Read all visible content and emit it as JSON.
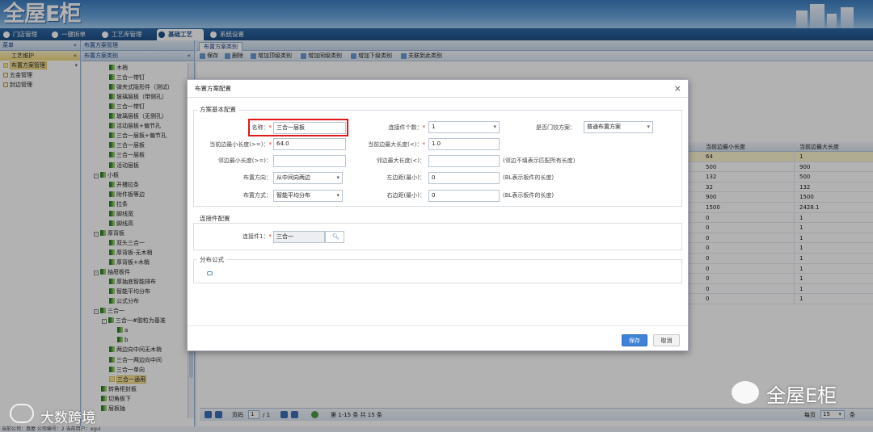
{
  "app": {
    "logo": "全屋E柜"
  },
  "nav": {
    "tabs": [
      "门店管理",
      "一键拆单",
      "工艺库管理",
      "基础工艺",
      "系统设置"
    ],
    "active": 3
  },
  "left_panel": {
    "header": "菜单",
    "section": "工艺维护",
    "items": [
      "布置方案管理",
      "五金管理",
      "封边管理"
    ],
    "selected": 0
  },
  "tree_panel": {
    "breadcrumb": "布置方案管理",
    "header": "布置方案类别",
    "items": [
      "木梢",
      "三合一带钉",
      "弹夹式隐形件（测试）",
      "玻璃层板（带侧孔）",
      "三合一带钉",
      "玻璃层板（无侧孔）",
      "活动层板+偏节孔",
      "三合一层板+偏节孔",
      "三合一层板",
      "三合一层板",
      "活动层板",
      "小板",
      "开槽拉条",
      "附件板等边",
      "拉条",
      "脚线宽",
      "脚线高",
      "厚背板",
      "双头三合一",
      "厚背板-无木梢",
      "厚背板+木梢",
      "抽屉板件",
      "厚抽底智能排布",
      "智能平均分布",
      "公式分布",
      "三合一",
      "三合一#胶粒为基准",
      "a",
      "b",
      "两边向中间无木梢",
      "三合一两边向中间",
      "三合一单向",
      "三合一通用",
      "转角柜封板",
      "切角板下",
      "层板抽"
    ],
    "selected_label": "三合一通用"
  },
  "main": {
    "tab": "布置方案类别",
    "toolbar": [
      "保存",
      "删除",
      "增加顶级类别",
      "增加同级类别",
      "增加下级类别",
      "关联到此类别"
    ],
    "grid_headers": [
      "当前边最小长度",
      "当前边最大长度"
    ],
    "grid_rows": [
      [
        "64",
        "1"
      ],
      [
        "500",
        "900"
      ],
      [
        "132",
        "500"
      ],
      [
        "32",
        "132"
      ],
      [
        "900",
        "1500"
      ],
      [
        "1500",
        "2428.1"
      ],
      [
        "0",
        "1"
      ],
      [
        "0",
        "1"
      ],
      [
        "0",
        "1"
      ],
      [
        "0",
        "1"
      ],
      [
        "0",
        "1"
      ],
      [
        "0",
        "1"
      ],
      [
        "0",
        "1"
      ],
      [
        "0",
        "1"
      ],
      [
        "0",
        "1"
      ]
    ],
    "highlighted_row": 0
  },
  "pager": {
    "page_label": "页码",
    "page": "1",
    "of": "/ 1",
    "summary": "第 1-15 条 共 15 条",
    "per_page_label": "每页",
    "per_page": "15",
    "unit": "条"
  },
  "status_bar": "当前公司：真屋   公司编号：2   当前用户：egui",
  "dialog": {
    "title": "布置方案配置",
    "section_basic": "方案基本配置",
    "fields": {
      "name_label": "名称：",
      "name_value": "三合一层板",
      "connector_count_label": "连接件个数：",
      "connector_count_value": "1",
      "is_door_label": "是否门铰方案：",
      "is_door_value": "普通布置方案",
      "cur_min_label": "当前边最小长度(>=)：",
      "cur_min_value": "64.0",
      "cur_max_label": "当前边最大长度(<)：",
      "cur_max_value": "1.0",
      "adj_min_label": "邻边最小长度(>=)：",
      "adj_min_value": "",
      "adj_max_label": "邻边最大长度(<)：",
      "adj_max_value": "",
      "adj_hint": "(邻边不填表示匹配所有长度)",
      "direction_label": "布置方向：",
      "direction_value": "从中间向两边",
      "left_margin_label": "左边距(最小)：",
      "left_margin_value": "0",
      "left_margin_hint": "(BL表示板件的长度)",
      "method_label": "布置方式：",
      "method_value": "智能平均分布",
      "right_margin_label": "右边距(最小)：",
      "right_margin_value": "0",
      "right_margin_hint": "(BL表示板件的长度)"
    },
    "section_connector": "连接件配置",
    "connector_label": "连接件1：",
    "connector_value": "三合一",
    "section_formula": "分布公式",
    "save": "保存",
    "cancel": "取消"
  },
  "watermarks": {
    "left": "大数跨境",
    "right": "全屋E柜"
  },
  "colors": {
    "accent": "#3f83d8",
    "highlight_box": "#e01818",
    "nav": "#1f4f86"
  }
}
